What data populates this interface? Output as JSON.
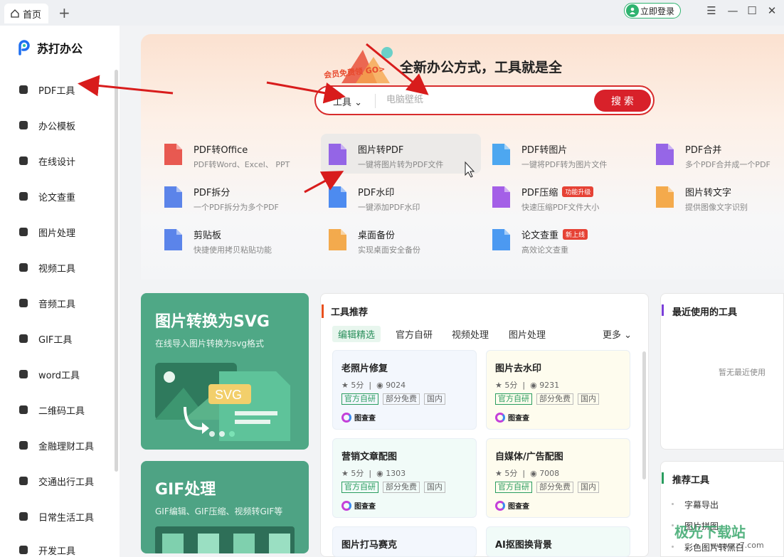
{
  "titlebar": {
    "tab_label": "首页",
    "login_label": "立即登录"
  },
  "sidebar": {
    "brand": "苏打办公",
    "items": [
      {
        "label": "PDF工具",
        "icon": "pdf-tool-icon"
      },
      {
        "label": "办公模板",
        "icon": "template-icon"
      },
      {
        "label": "在线设计",
        "icon": "design-icon"
      },
      {
        "label": "论文查重",
        "icon": "paper-check-icon"
      },
      {
        "label": "图片处理",
        "icon": "image-process-icon"
      },
      {
        "label": "视频工具",
        "icon": "video-icon"
      },
      {
        "label": "音频工具",
        "icon": "audio-icon"
      },
      {
        "label": "GIF工具",
        "icon": "gif-icon"
      },
      {
        "label": "word工具",
        "icon": "word-icon"
      },
      {
        "label": "二维码工具",
        "icon": "qrcode-icon"
      },
      {
        "label": "金融理财工具",
        "icon": "finance-icon"
      },
      {
        "label": "交通出行工具",
        "icon": "travel-icon"
      },
      {
        "label": "日常生活工具",
        "icon": "calendar-icon"
      },
      {
        "label": "开发工具",
        "icon": "dev-icon"
      }
    ]
  },
  "hero": {
    "slogan": "全新办公方式，工具就是全",
    "promo": "会员免费领 GO>",
    "search_type": "工具",
    "search_placeholder": "电脑壁纸",
    "search_button": "搜 索"
  },
  "tools": [
    {
      "name": "PDF转Office",
      "desc": "PDF转Word、Excel、 PPT",
      "badge": "",
      "color": "#e5483f",
      "icon": "pdf-to-office-icon"
    },
    {
      "name": "图片转PDF",
      "desc": "一键将图片转为PDF文件",
      "badge": "",
      "color": "#8b56e6",
      "icon": "image-to-pdf-icon"
    },
    {
      "name": "PDF转图片",
      "desc": "一键将PDF转为图片文件",
      "badge": "",
      "color": "#3a9ff0",
      "icon": "pdf-to-image-icon"
    },
    {
      "name": "PDF合并",
      "desc": "多个PDF合并成一个PDF",
      "badge": "",
      "color": "#8b56e6",
      "icon": "pdf-merge-icon"
    },
    {
      "name": "PDF拆分",
      "desc": "一个PDF拆分为多个PDF",
      "badge": "",
      "color": "#4a78e8",
      "icon": "pdf-split-icon"
    },
    {
      "name": "PDF水印",
      "desc": "一键添加PDF水印",
      "badge": "",
      "color": "#3a7ff0",
      "icon": "pdf-watermark-icon"
    },
    {
      "name": "PDF压缩",
      "desc": "快速压缩PDF文件大小",
      "badge": "功能升级",
      "color": "#9a4fe6",
      "icon": "pdf-compress-icon"
    },
    {
      "name": "图片转文字",
      "desc": "提供图像文字识别",
      "badge": "",
      "color": "#f3a23a",
      "icon": "image-to-text-icon"
    },
    {
      "name": "剪贴板",
      "desc": "快捷使用拷贝粘贴功能",
      "badge": "",
      "color": "#4a78e8",
      "icon": "clipboard-icon"
    },
    {
      "name": "桌面备份",
      "desc": "实现桌面安全备份",
      "badge": "",
      "color": "#f3a23a",
      "icon": "desktop-backup-icon"
    },
    {
      "name": "论文查重",
      "desc": "高效论文查重",
      "badge": "新上线",
      "color": "#3a8ff0",
      "icon": "paper-check-icon"
    }
  ],
  "banners": [
    {
      "title": "图片转换为SVG",
      "sub": "在线导入图片转换为svg格式",
      "svg_label": "SVG"
    },
    {
      "title": "GIF处理",
      "sub": "GIF编辑、GIF压缩、视频转GIF等"
    }
  ],
  "recommend": {
    "title": "工具推荐",
    "tabs": [
      "编辑精选",
      "官方自研",
      "视频处理",
      "图片处理"
    ],
    "more": "更多",
    "cards": [
      {
        "name": "老照片修复",
        "score": "5分",
        "views": "9024",
        "tags": [
          "官方自研",
          "部分免费",
          "国内"
        ],
        "source": "图查查"
      },
      {
        "name": "图片去水印",
        "score": "5分",
        "views": "9231",
        "tags": [
          "官方自研",
          "部分免费",
          "国内"
        ],
        "source": "图查查"
      },
      {
        "name": "营销文章配图",
        "score": "5分",
        "views": "1303",
        "tags": [
          "官方自研",
          "部分免费",
          "国内"
        ],
        "source": "图查查"
      },
      {
        "name": "自媒体/广告配图",
        "score": "5分",
        "views": "7008",
        "tags": [
          "官方自研",
          "部分免费",
          "国内"
        ],
        "source": "图查查"
      },
      {
        "name": "图片打马赛克"
      },
      {
        "name": "AI抠图换背景"
      }
    ]
  },
  "recent": {
    "title": "最近使用的工具",
    "empty": "暂无最近使用"
  },
  "suggest": {
    "title": "推荐工具",
    "items": [
      "字幕导出",
      "图片拼图",
      "彩色图片转黑白"
    ]
  },
  "watermark": {
    "text": "极光下载站",
    "url": "www.xz7.com"
  }
}
